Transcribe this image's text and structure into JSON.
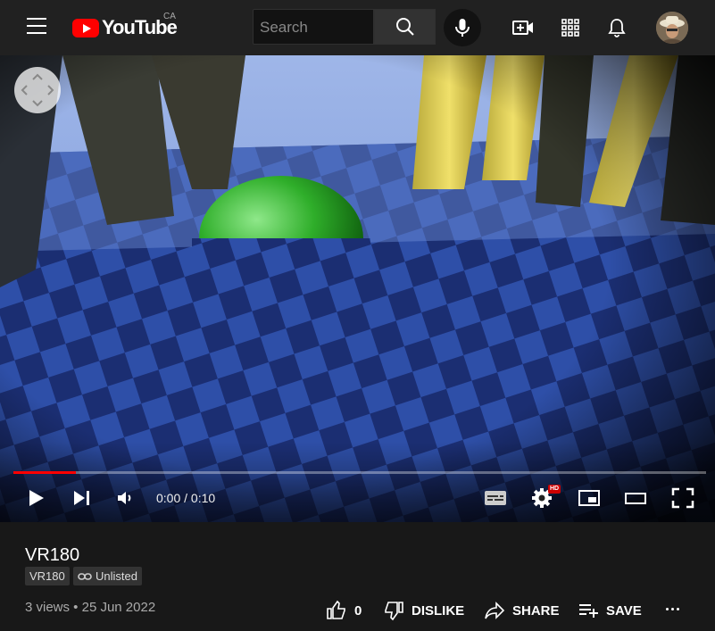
{
  "header": {
    "logo_text": "YouTube",
    "country_code": "CA",
    "search_placeholder": "Search",
    "icons": [
      "menu-icon",
      "search-icon",
      "microphone-icon",
      "create-video-icon",
      "apps-grid-icon",
      "notifications-bell-icon"
    ]
  },
  "player": {
    "time_display": "0:00 / 0:10",
    "progress": 0.09,
    "hd_label": "HD",
    "accent_color": "#ff0000",
    "icons": [
      "vr-direction-pad-icon",
      "play-icon",
      "next-icon",
      "volume-icon",
      "subtitles-icon",
      "settings-gear-icon",
      "miniplayer-icon",
      "theater-mode-icon",
      "fullscreen-icon"
    ]
  },
  "video": {
    "title": "VR180",
    "badges": [
      {
        "label": "VR180"
      },
      {
        "label": "Unlisted",
        "icon": "link-icon"
      }
    ],
    "meta": "3 views • 25 Jun 2022"
  },
  "actions": {
    "like_count": "0",
    "dislike_label": "DISLIKE",
    "share_label": "SHARE",
    "save_label": "SAVE"
  }
}
